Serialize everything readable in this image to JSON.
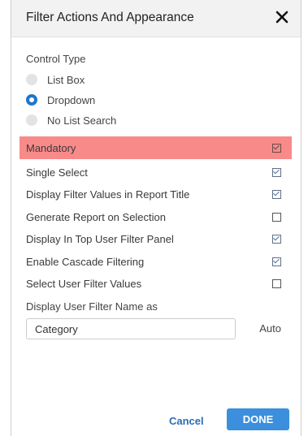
{
  "dialog": {
    "title": "Filter Actions And Appearance",
    "close_icon": "close-x-icon"
  },
  "control_type": {
    "label": "Control Type",
    "options": [
      {
        "label": "List Box",
        "selected": false
      },
      {
        "label": "Dropdown",
        "selected": true
      },
      {
        "label": "No List Search",
        "selected": false
      }
    ]
  },
  "options": [
    {
      "label": "Mandatory",
      "checked": true,
      "highlighted": true
    },
    {
      "label": "Single Select",
      "checked": true,
      "highlighted": false
    },
    {
      "label": "Display Filter Values in Report Title",
      "checked": true,
      "highlighted": false
    },
    {
      "label": "Generate Report on Selection",
      "checked": false,
      "highlighted": false
    },
    {
      "label": "Display In Top User Filter Panel",
      "checked": true,
      "highlighted": false
    },
    {
      "label": "Enable Cascade Filtering",
      "checked": true,
      "highlighted": false
    },
    {
      "label": "Select User Filter Values",
      "checked": false,
      "highlighted": false
    }
  ],
  "filter_name": {
    "label": "Display User Filter Name as",
    "value": "Category",
    "auto_label": "Auto"
  },
  "footer": {
    "cancel_label": "Cancel",
    "done_label": "DONE"
  },
  "colors": {
    "accent": "#1f76c8",
    "done_button": "#3c8fdc",
    "highlight": "#f98a8a"
  }
}
